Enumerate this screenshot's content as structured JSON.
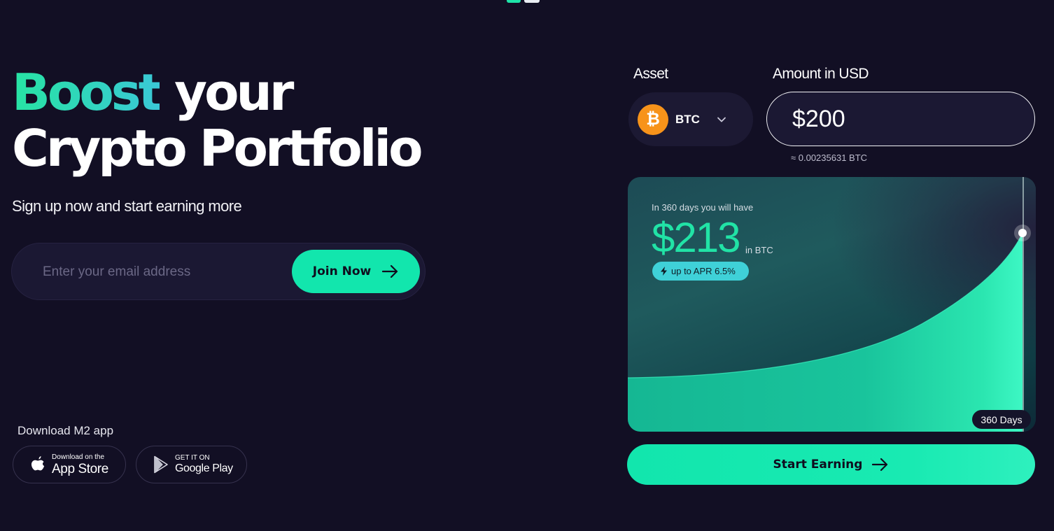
{
  "hero": {
    "title_accent": "Boost",
    "title_rest_line1": " your",
    "title_line2": "Crypto Portfolio",
    "subtitle": "Sign up now and start earning more"
  },
  "signup": {
    "email_placeholder": "Enter your email address",
    "email_value": "",
    "join_label": "Join Now"
  },
  "download": {
    "label": "Download M2 app",
    "app_store": {
      "small": "Download on the",
      "big": "App Store",
      "icon": "apple-icon"
    },
    "google_play": {
      "small": "GET IT ON",
      "big": "Google Play",
      "icon": "google-play-icon"
    }
  },
  "calculator": {
    "asset_label": "Asset",
    "amount_label": "Amount in USD",
    "asset": {
      "symbol": "BTC",
      "icon": "bitcoin-icon",
      "icon_color": "#f7931a"
    },
    "amount_value": "$200",
    "btc_equivalent": "≈ 0.00235631 BTC",
    "result_caption": "In 360 days you will have",
    "result_value": "$213",
    "result_unit": "in BTC",
    "apr_badge": "up to APR 6.5%",
    "days_badge": "360 Days",
    "start_label": "Start Earning"
  },
  "colors": {
    "background": "#120f24",
    "accent": "#12e6ad",
    "accent_text": "#21e3a6",
    "apr_badge": "#3fd1d8"
  }
}
